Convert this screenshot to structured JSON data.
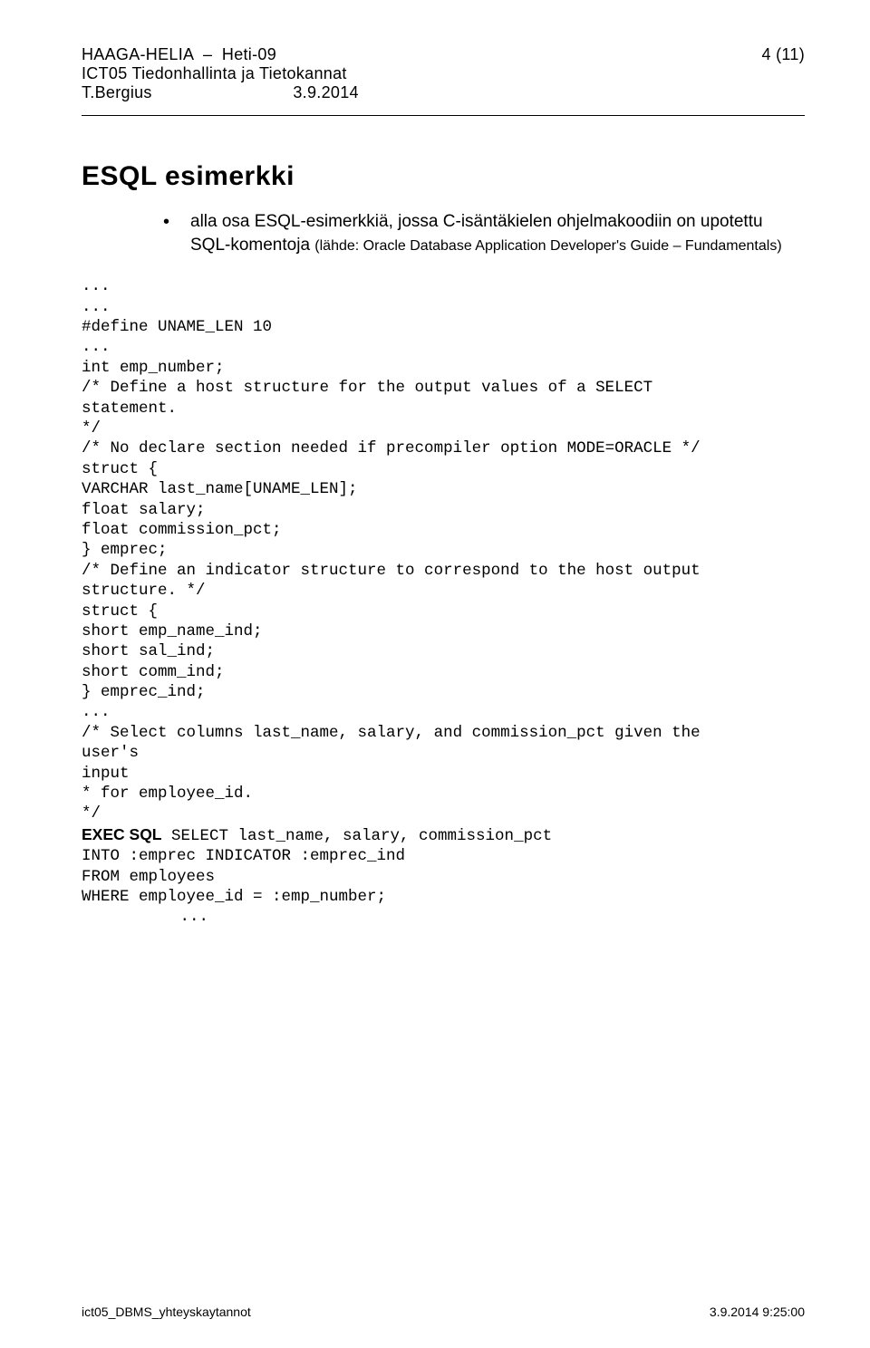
{
  "header": {
    "org": "HAAGA-HELIA",
    "program": "Heti-09",
    "course": "ICT05  Tiedonhallinta ja Tietokannat",
    "author": "T.Bergius",
    "date": "3.9.2014",
    "page": "4 (11)"
  },
  "title": "ESQL esimerkki",
  "bullet": {
    "main": "alla osa ESQL-esimerkkiä, jossa C-isäntäkielen ohjelmakoodiin on upotettu SQL-komentoja (",
    "source_prefix": "(lähde: Oracle Database Application Developer's Guide – Fundamentals)"
  },
  "code": {
    "l1": "...",
    "l2": "...",
    "l3": "#define UNAME_LEN 10",
    "l4": "...",
    "l5": "int emp_number;",
    "l6": "/* Define a host structure for the output values of a SELECT",
    "l7": "statement.",
    "l8": "*/",
    "l9": "/* No declare section needed if precompiler option MODE=ORACLE */",
    "l10": "struct {",
    "l11": "VARCHAR last_name[UNAME_LEN];",
    "l12": "float salary;",
    "l13": "float commission_pct;",
    "l14": "} emprec;",
    "l15": "/* Define an indicator structure to correspond to the host output",
    "l16": "structure. */",
    "l17": "struct {",
    "l18": "short emp_name_ind;",
    "l19": "short sal_ind;",
    "l20": "short comm_ind;",
    "l21": "} emprec_ind;",
    "l22": "...",
    "l23": "/* Select columns last_name, salary, and commission_pct given the",
    "l24": "user's",
    "l25": "input",
    "l26": "* for employee_id.",
    "l27": "*/",
    "exec_label": "EXEC SQL",
    "l28b": " SELECT last_name, salary, commission_pct",
    "l29": "INTO :emprec INDICATOR :emprec_ind",
    "l30": "FROM employees",
    "l31": "WHERE employee_id = :emp_number;",
    "l32": "..."
  },
  "footer": {
    "left": "ict05_DBMS_yhteyskaytannot",
    "right": "3.9.2014 9:25:00"
  }
}
